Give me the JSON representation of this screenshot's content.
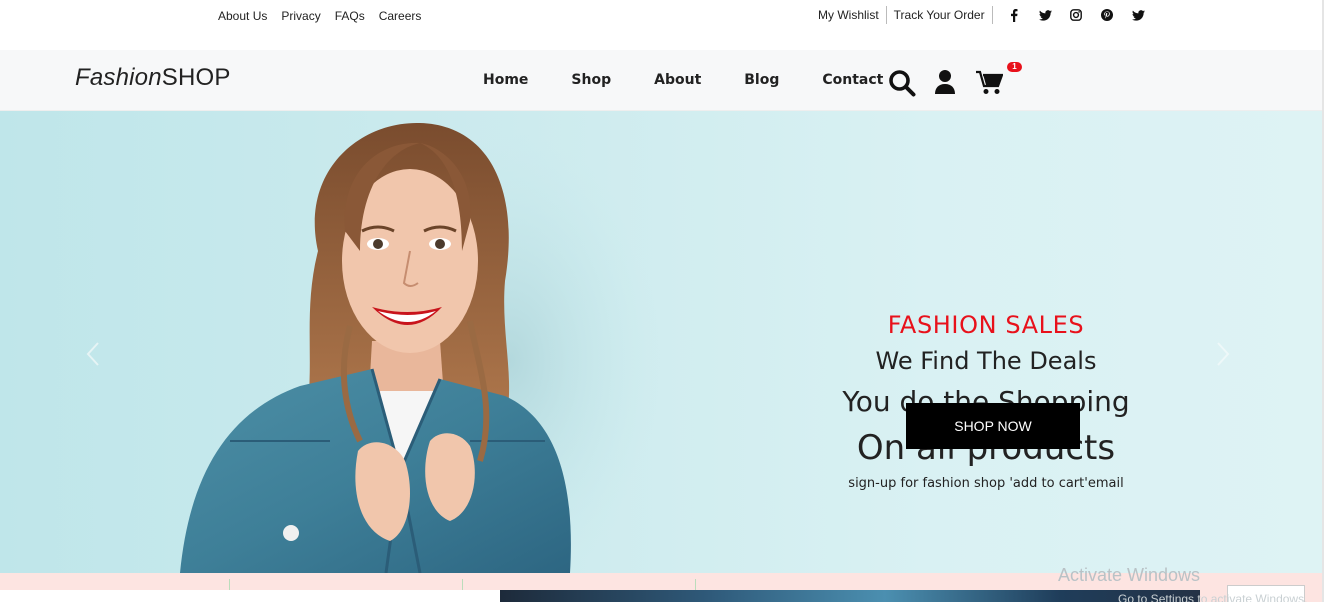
{
  "topbar": {
    "left_links": [
      "About Us",
      "Privacy",
      "FAQs",
      "Careers"
    ],
    "right_links": [
      "My Wishlist",
      "Track Your Order"
    ],
    "social_icons": [
      "facebook-icon",
      "twitter-icon",
      "instagram-icon",
      "pinterest-icon",
      "twitter-icon"
    ]
  },
  "navbar": {
    "logo_italic": "Fashion",
    "logo_regular": "SHOP",
    "menu": [
      "Home",
      "Shop",
      "About",
      "Blog",
      "Contact"
    ],
    "icons": [
      "search-icon",
      "user-icon",
      "cart-icon"
    ],
    "cart_count": "1"
  },
  "hero": {
    "tagline": "FASHION SALES",
    "line1": "We Find The Deals",
    "line2": "You do the Shopping",
    "line3": "On all products",
    "subtext": "sign-up for fashion shop 'add to cart'email",
    "button_label": "SHOP NOW",
    "accent_color": "#e8111b"
  },
  "watermark": {
    "title": "Activate Windows",
    "subtitle": "Go to Settings to activate Windows."
  }
}
